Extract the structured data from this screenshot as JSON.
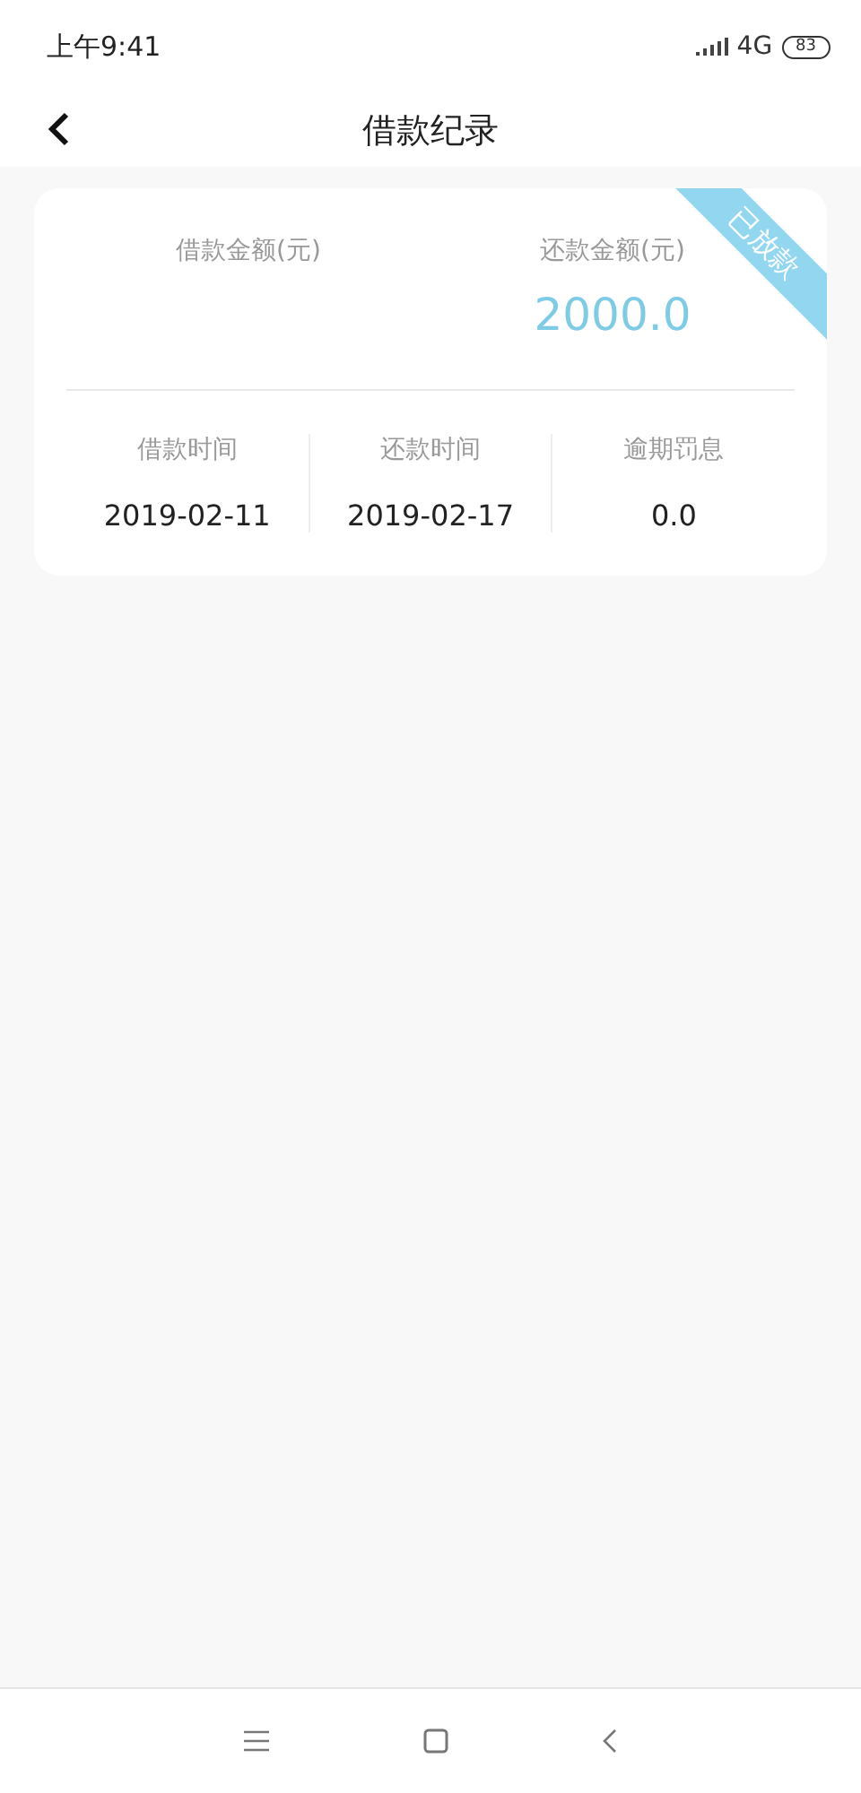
{
  "status_bar": {
    "time": "上午9:41",
    "network": "4G",
    "battery": "83"
  },
  "header": {
    "title": "借款纪录"
  },
  "record": {
    "ribbon": "已放款",
    "amounts": [
      {
        "label": "借款金额(元)"
      },
      {
        "label": "还款金额(元)",
        "value": "2000.0"
      }
    ],
    "details": [
      {
        "label": "借款时间",
        "value": "2019-02-11"
      },
      {
        "label": "还款时间",
        "value": "2019-02-17"
      },
      {
        "label": "逾期罚息",
        "value": "0.0"
      }
    ]
  }
}
